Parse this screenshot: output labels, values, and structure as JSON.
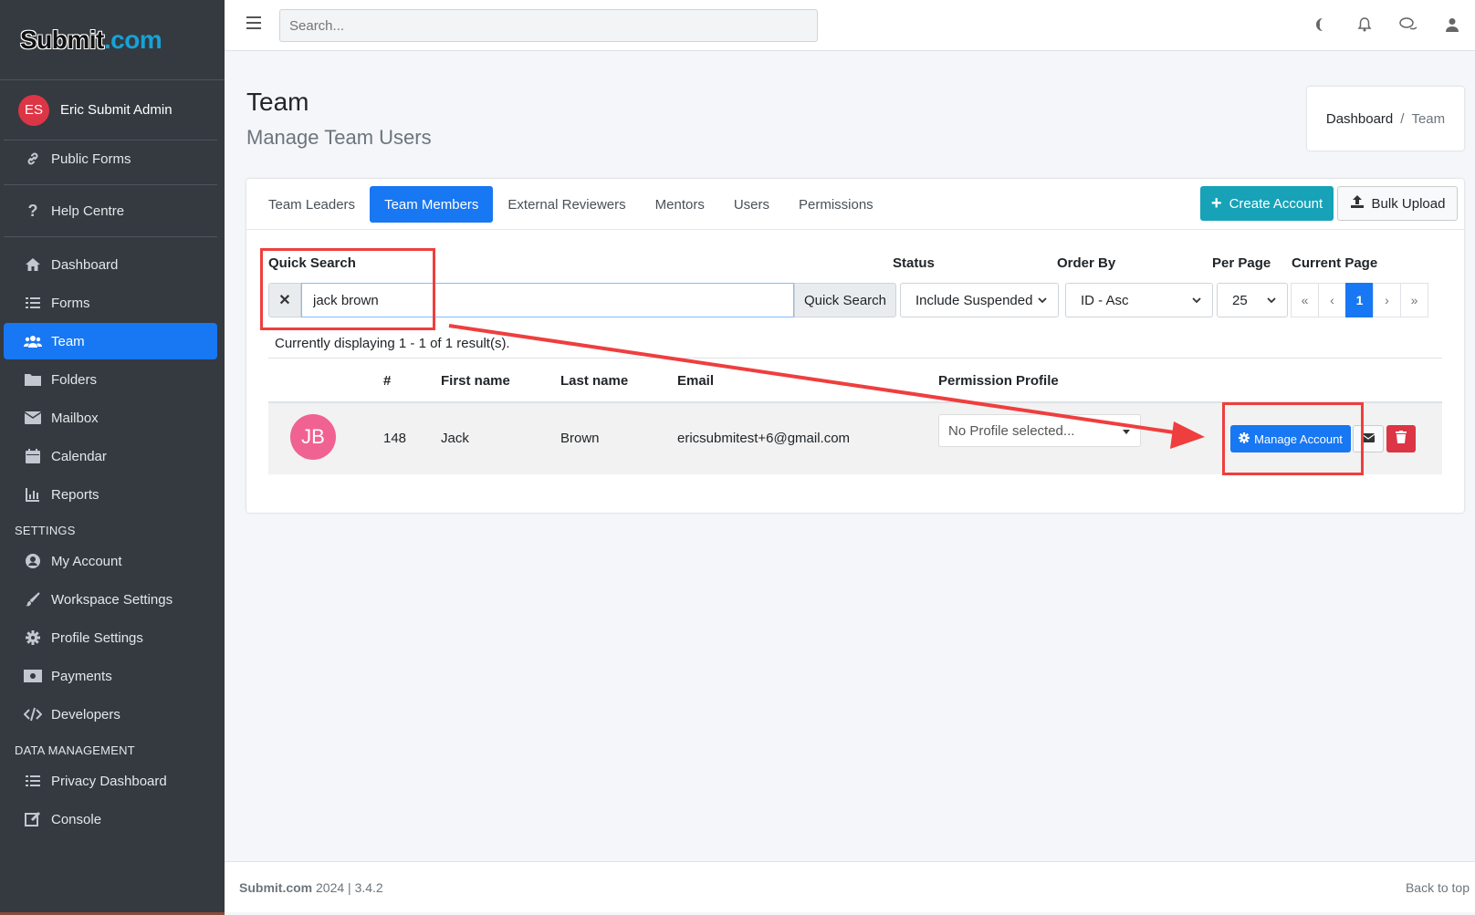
{
  "brand": {
    "part1": "Submit",
    "part2": ".com"
  },
  "user": {
    "initials": "ES",
    "name": "Eric Submit Admin"
  },
  "sidebar": {
    "top_items": [
      {
        "label": "Public Forms",
        "icon": "link-icon"
      },
      {
        "label": "Help Centre",
        "icon": "question-icon"
      }
    ],
    "main_items": [
      {
        "label": "Dashboard",
        "icon": "home-icon"
      },
      {
        "label": "Forms",
        "icon": "list-icon"
      },
      {
        "label": "Team",
        "icon": "users-icon"
      },
      {
        "label": "Folders",
        "icon": "folder-icon"
      },
      {
        "label": "Mailbox",
        "icon": "envelope-icon"
      },
      {
        "label": "Calendar",
        "icon": "calendar-icon"
      },
      {
        "label": "Reports",
        "icon": "chart-icon"
      }
    ],
    "settings_header": "SETTINGS",
    "settings_items": [
      {
        "label": "My Account",
        "icon": "user-circle-icon"
      },
      {
        "label": "Workspace Settings",
        "icon": "paintbrush-icon"
      },
      {
        "label": "Profile Settings",
        "icon": "gear-icon"
      },
      {
        "label": "Payments",
        "icon": "money-icon"
      },
      {
        "label": "Developers",
        "icon": "code-icon"
      }
    ],
    "data_header": "DATA MANAGEMENT",
    "data_items": [
      {
        "label": "Privacy Dashboard",
        "icon": "list-icon"
      },
      {
        "label": "Console",
        "icon": "edit-icon"
      }
    ]
  },
  "topbar": {
    "search_placeholder": "Search..."
  },
  "page": {
    "title": "Team",
    "subtitle": "Manage Team Users"
  },
  "breadcrumb": {
    "home": "Dashboard",
    "separator": "/",
    "current": "Team"
  },
  "tabs": [
    "Team Leaders",
    "Team Members",
    "External Reviewers",
    "Mentors",
    "Users",
    "Permissions"
  ],
  "actions": {
    "create": "Create Account",
    "bulk": "Bulk Upload"
  },
  "filters": {
    "quick_search_label": "Quick Search",
    "quick_search_value": "jack brown",
    "quick_search_button": "Quick Search",
    "status_label": "Status",
    "status_value": "Include Suspended",
    "order_label": "Order By",
    "order_value": "ID - Asc",
    "per_page_label": "Per Page",
    "per_page_value": "25",
    "current_page_label": "Current Page"
  },
  "pager": {
    "first": "«",
    "prev": "‹",
    "current": "1",
    "next": "›",
    "last": "»"
  },
  "result_text": "Currently displaying 1 - 1 of 1 result(s).",
  "table": {
    "headers": {
      "id": "#",
      "first": "First name",
      "last": "Last name",
      "email": "Email",
      "profile": "Permission Profile"
    },
    "row": {
      "initials": "JB",
      "id": "148",
      "first": "Jack",
      "last": "Brown",
      "email": "ericsubmitest+6@gmail.com",
      "profile": "No Profile selected...",
      "manage": "Manage Account"
    }
  },
  "footer": {
    "brand": "Submit.com",
    "version": " 2024 | 3.4.2",
    "back_to_top": "Back to top"
  },
  "colors": {
    "primary": "#1877f2",
    "info": "#17a2b8",
    "danger": "#dc3545",
    "sidebar": "#343a40",
    "annotation": "#ef3e3e"
  }
}
